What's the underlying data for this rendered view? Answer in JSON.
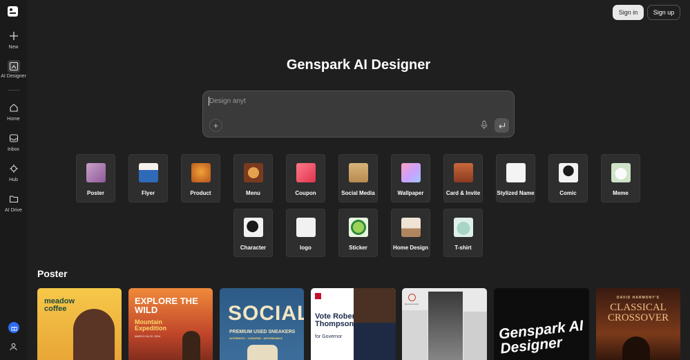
{
  "sidebar": {
    "items": [
      {
        "label": "New",
        "icon": "plus-icon"
      },
      {
        "label": "AI Designer",
        "icon": "ai-designer-icon"
      },
      {
        "label": "Home",
        "icon": "home-icon"
      },
      {
        "label": "Inbox",
        "icon": "inbox-icon"
      },
      {
        "label": "Hub",
        "icon": "hub-icon"
      },
      {
        "label": "AI Drive",
        "icon": "folder-icon"
      }
    ]
  },
  "header": {
    "signin": "Sign in",
    "signup": "Sign up"
  },
  "main": {
    "title": "Genspark AI Designer",
    "prompt": {
      "value": "Design anyt"
    },
    "categories": [
      "Poster",
      "Flyer",
      "Product",
      "Menu",
      "Coupon",
      "Social Media",
      "Wallpaper",
      "Card & Invite",
      "Stylized Name",
      "Comic",
      "Meme",
      "Character",
      "logo",
      "Sticker",
      "Home Design",
      "T-shirt"
    ],
    "section_title": "Poster",
    "posters": [
      {
        "text": "meadow coffee"
      },
      {
        "text": "EXPLORE THE WILD",
        "sub": "Mountain Expedition",
        "date": "MARCH 15-22, 2024"
      },
      {
        "text": "SOCIAL",
        "sub": "PREMIUM USED SNEAKERS",
        "sub2": "AUTHENTIC · CURATED · AFFORDABLE"
      },
      {
        "text": "Vote Robert Thompson",
        "sub": "for Governor"
      },
      {
        "text": "@ecuprestudio"
      },
      {
        "text": "Genspark AI Designer"
      },
      {
        "text": "CLASSICAL CROSSOVER",
        "sub": "DAVID HARMONY'S"
      }
    ]
  },
  "colors": {
    "background": "#1f1f1f",
    "accent": "#2d6cf5"
  }
}
